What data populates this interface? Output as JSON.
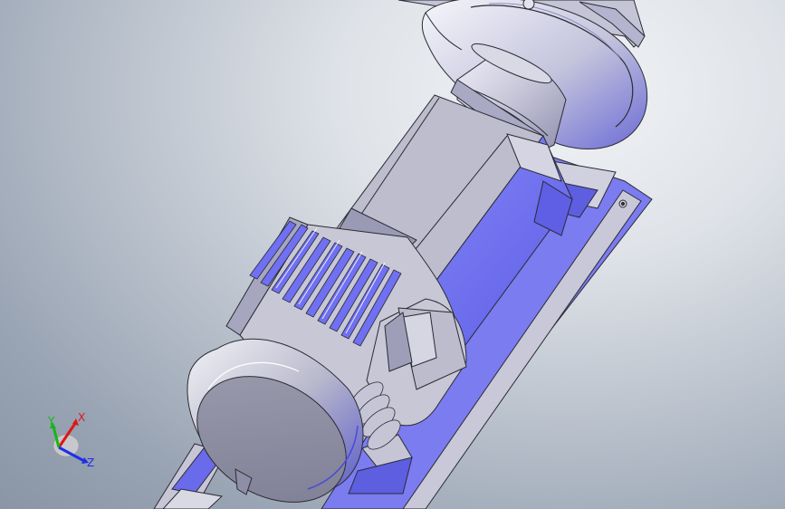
{
  "viewport": {
    "background_colors": [
      "#eef0f3",
      "#9aa4b3"
    ],
    "model_colors": {
      "housing": "#c9c8d8",
      "housing_shade": "#8f8fb0",
      "blue_face": "#6f70f2",
      "blue_dark": "#4a4bd6",
      "edge": "#2b2b34"
    }
  },
  "triad": {
    "x_label": "X",
    "y_label": "Y",
    "z_label": "Z",
    "x_color": "#e01515",
    "y_color": "#14b814",
    "z_color": "#1d2fe6"
  }
}
